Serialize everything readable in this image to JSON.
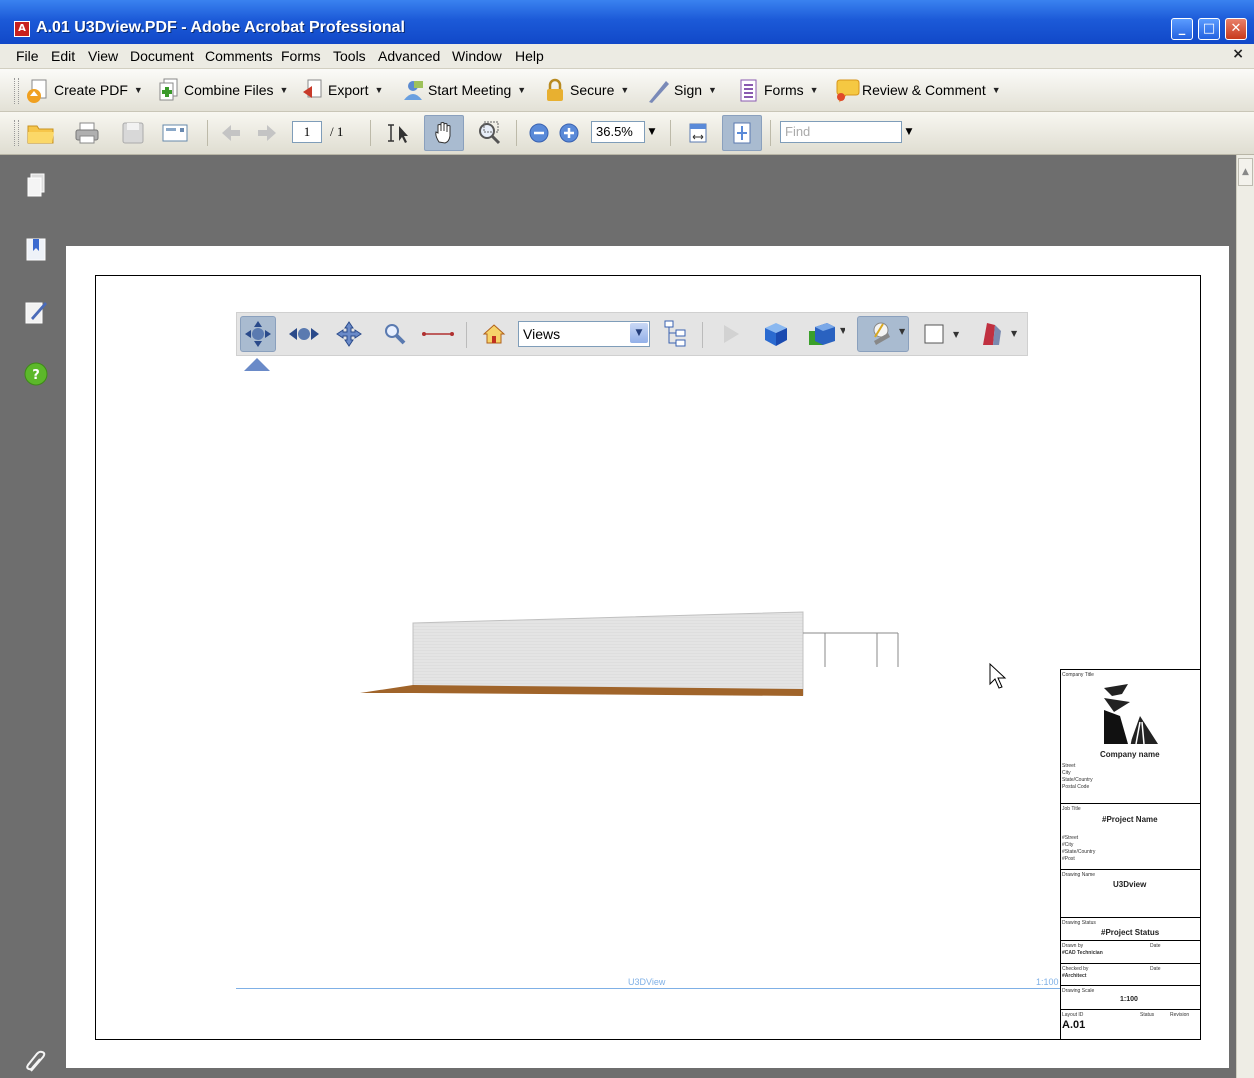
{
  "window": {
    "title": "A.01 U3Dview.PDF - Adobe Acrobat Professional",
    "buttons": [
      "minimize",
      "maximize",
      "close"
    ]
  },
  "menubar": {
    "items": [
      "File",
      "Edit",
      "View",
      "Document",
      "Comments",
      "Forms",
      "Tools",
      "Advanced",
      "Window",
      "Help"
    ],
    "close_glyph": "×"
  },
  "toolbar_tasks": {
    "create_pdf": "Create PDF",
    "combine_files": "Combine Files",
    "export": "Export",
    "start_meeting": "Start Meeting",
    "secure": "Secure",
    "sign": "Sign",
    "forms": "Forms",
    "review_comment": "Review & Comment"
  },
  "toolbar_nav": {
    "page_current": "1",
    "page_total": "/ 1",
    "zoom": "36.5%",
    "find_placeholder": "Find"
  },
  "toolbar_3d": {
    "views_select": "Views"
  },
  "drawing": {
    "footer_label": "U3DView",
    "footer_scale": "1:100"
  },
  "title_block": {
    "company_title_label": "Company Title",
    "company_name": "Company name",
    "address_lines": [
      "Street",
      "City",
      "State/Country",
      "Postal Code"
    ],
    "job_title_label": "Job Title",
    "project_name": "#Project Name",
    "project_address": [
      "#Street",
      "#City",
      "#State/Country",
      "#Post"
    ],
    "drawing_name_label": "Drawing Name",
    "drawing_name": "U3Dview",
    "drawing_status_label": "Drawing Status",
    "project_status": "#Project Status",
    "drawn_by_label": "Drawn by",
    "drawn_by": "#CAD Technician",
    "date_label": "Date",
    "checked_by_label": "Checked by",
    "checked_by": "#Architect",
    "drawing_scale_label": "Drawing Scale",
    "drawing_scale": "1:100",
    "layout_id_label": "Layout ID",
    "status_label": "Status",
    "revision_label": "Revision",
    "layout_id": "A.01"
  },
  "colors": {
    "titlebar": "#1c5ad8",
    "workspace": "#6e6e6e",
    "footer_line": "#7fb0e6",
    "ground": "#a0642a"
  }
}
